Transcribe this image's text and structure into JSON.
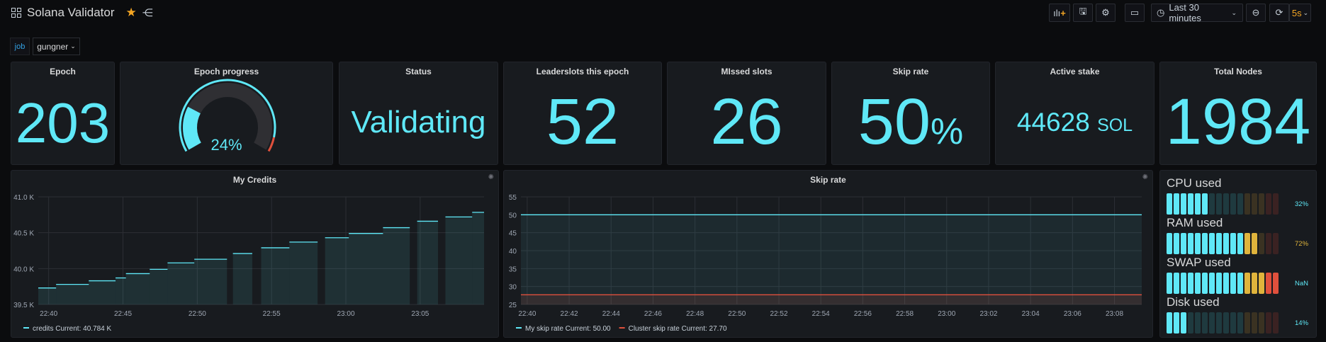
{
  "header": {
    "title": "Solana Validator",
    "time_range": "Last 30 minutes",
    "refresh": "5s"
  },
  "variables": {
    "label": "job",
    "value": "gungner"
  },
  "stats": {
    "epoch": {
      "title": "Epoch",
      "value": "203"
    },
    "epoch_progress": {
      "title": "Epoch progress",
      "value": "24%",
      "percent": 24
    },
    "status": {
      "title": "Status",
      "value": "Validating"
    },
    "leaderslots": {
      "title": "Leaderslots this epoch",
      "value": "52"
    },
    "missed": {
      "title": "MIssed slots",
      "value": "26"
    },
    "skip": {
      "title": "Skip rate",
      "value": "50",
      "unit": "%"
    },
    "stake": {
      "title": "Active stake",
      "value": "44628",
      "unit": "SOL"
    },
    "nodes": {
      "title": "Total Nodes",
      "value": "1984"
    }
  },
  "resources": [
    {
      "label": "CPU used",
      "value": "32%",
      "lit": 6,
      "color": "#5fe8f7"
    },
    {
      "label": "RAM used",
      "value": "72%",
      "lit": 13,
      "color": "#e0b43c"
    },
    {
      "label": "SWAP used",
      "value": "NaN",
      "lit": 16,
      "color": "#5fe8f7"
    },
    {
      "label": "Disk used",
      "value": "14%",
      "lit": 3,
      "color": "#5fe8f7"
    }
  ],
  "colors": {
    "cyan": "#5fe8f7",
    "yellow": "#e0b43c",
    "red": "#e0503c"
  },
  "chart_data": [
    {
      "type": "area",
      "title": "My Credits",
      "ylim": [
        39.5,
        41.0
      ],
      "yticks": [
        "39.5 K",
        "40.0 K",
        "40.5 K",
        "41.0 K"
      ],
      "ytick_values": [
        39.5,
        40.0,
        40.5,
        41.0
      ],
      "xlim_min": [
        -0.7,
        29.3
      ],
      "xticks": [
        "22:40",
        "22:45",
        "22:50",
        "22:55",
        "23:00",
        "23:05"
      ],
      "xtick_min": [
        0,
        5,
        10,
        15,
        20,
        25
      ],
      "segments": [
        [
          -0.7,
          0.5,
          [
            39.73
          ]
        ],
        [
          0.5,
          2.7,
          [
            39.78
          ]
        ],
        [
          2.7,
          4.5,
          [
            39.83
          ]
        ],
        [
          4.5,
          5.2,
          [
            39.87
          ]
        ],
        [
          5.2,
          6.8,
          [
            39.93
          ]
        ],
        [
          6.8,
          8.0,
          [
            39.99
          ]
        ],
        [
          8.0,
          9.8,
          [
            40.08,
            40.08
          ]
        ],
        [
          9.8,
          12.0,
          [
            40.13
          ]
        ],
        [
          12.4,
          13.7,
          [
            40.21
          ]
        ],
        [
          14.3,
          16.2,
          [
            40.29
          ]
        ],
        [
          16.2,
          18.1,
          [
            40.37
          ]
        ],
        [
          18.6,
          20.2,
          [
            40.43
          ]
        ],
        [
          20.2,
          22.5,
          [
            40.49
          ]
        ],
        [
          22.5,
          24.3,
          [
            40.57
          ]
        ],
        [
          24.8,
          26.2,
          [
            40.66
          ]
        ],
        [
          26.7,
          28.5,
          [
            40.72
          ]
        ],
        [
          28.5,
          29.3,
          [
            40.784
          ]
        ]
      ],
      "legend": [
        {
          "name": "credits",
          "current": "Current: 40.784 K",
          "color": "#5fe8f7"
        }
      ]
    },
    {
      "type": "area",
      "title": "Skip rate",
      "ylim": [
        25,
        55
      ],
      "yticks": [
        "25",
        "30",
        "35",
        "40",
        "45",
        "50",
        "55"
      ],
      "ytick_values": [
        25,
        30,
        35,
        40,
        45,
        50,
        55
      ],
      "xlim_min": [
        -0.3,
        29.3
      ],
      "xticks": [
        "22:40",
        "22:42",
        "22:44",
        "22:46",
        "22:48",
        "22:50",
        "22:52",
        "22:54",
        "22:56",
        "22:58",
        "23:00",
        "23:02",
        "23:04",
        "23:06",
        "23:08"
      ],
      "xtick_min": [
        0,
        2,
        4,
        6,
        8,
        10,
        12,
        14,
        16,
        18,
        20,
        22,
        24,
        26,
        28
      ],
      "series": [
        {
          "name": "My skip rate",
          "value": 50.0,
          "color": "#5fe8f7"
        },
        {
          "name": "Cluster skip rate",
          "value": 27.7,
          "color": "#e0503c"
        }
      ],
      "legend": [
        {
          "name": "My skip rate",
          "current": "Current: 50.00",
          "color": "#5fe8f7"
        },
        {
          "name": "Cluster skip rate",
          "current": "Current: 27.70",
          "color": "#e0503c"
        }
      ]
    }
  ]
}
